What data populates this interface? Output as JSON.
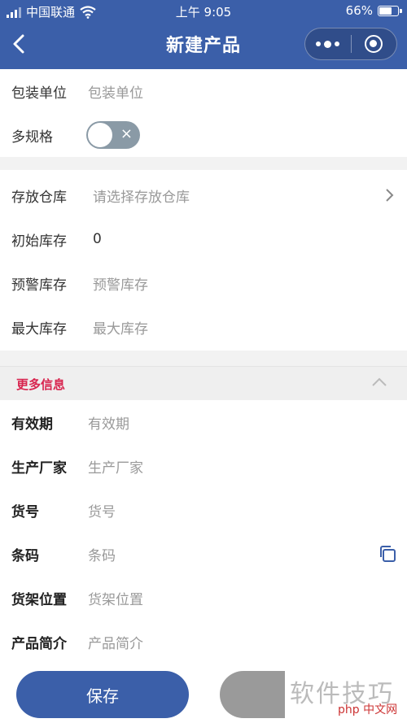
{
  "status_bar": {
    "carrier": "中国联通",
    "time": "上午 9:05",
    "battery": "66%"
  },
  "nav": {
    "title": "新建产品",
    "back_icon": "back-arrow-icon",
    "more_icon": "more-dots-icon",
    "close_icon": "mini-program-close-icon"
  },
  "basic": {
    "package_unit": {
      "label": "包装单位",
      "placeholder": "包装单位"
    },
    "multi_spec": {
      "label": "多规格",
      "enabled": false,
      "toggle_mark": "×"
    }
  },
  "stock": {
    "warehouse": {
      "label": "存放仓库",
      "placeholder": "请选择存放仓库"
    },
    "initial": {
      "label": "初始库存",
      "value": "0"
    },
    "warning": {
      "label": "预警库存",
      "placeholder": "预警库存"
    },
    "max": {
      "label": "最大库存",
      "placeholder": "最大库存"
    }
  },
  "more": {
    "title": "更多信息",
    "fields": [
      {
        "label": "有效期",
        "placeholder": "有效期"
      },
      {
        "label": "生产厂家",
        "placeholder": "生产厂家"
      },
      {
        "label": "货号",
        "placeholder": "货号"
      },
      {
        "label": "条码",
        "placeholder": "条码"
      },
      {
        "label": "货架位置",
        "placeholder": "货架位置"
      },
      {
        "label": "产品简介",
        "placeholder": "产品简介"
      }
    ]
  },
  "footer": {
    "save_label": "保存"
  },
  "watermark": {
    "text": "软件技巧",
    "logo": "php 中文网"
  },
  "colors": {
    "primary": "#3b5fa9",
    "accent": "#d8254f"
  }
}
